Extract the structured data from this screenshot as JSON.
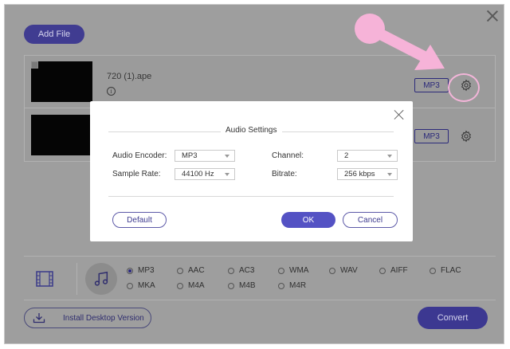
{
  "toolbar": {
    "add_file_label": "Add File"
  },
  "files": [
    {
      "name": "720 (1).ape",
      "format": "MP3"
    },
    {
      "name": "",
      "format": "MP3"
    }
  ],
  "audio_settings": {
    "title": "Audio Settings",
    "encoder_label": "Audio Encoder:",
    "encoder_value": "MP3",
    "sample_rate_label": "Sample Rate:",
    "sample_rate_value": "44100 Hz",
    "channel_label": "Channel:",
    "channel_value": "2",
    "bitrate_label": "Bitrate:",
    "bitrate_value": "256 kbps",
    "default_label": "Default",
    "ok_label": "OK",
    "cancel_label": "Cancel"
  },
  "formats": {
    "selected": "MP3",
    "row1": [
      "MP3",
      "AAC",
      "AC3",
      "WMA",
      "WAV",
      "AIFF",
      "FLAC"
    ],
    "row2": [
      "MKA",
      "M4A",
      "M4B",
      "M4R"
    ]
  },
  "footer": {
    "install_label": "Install Desktop Version",
    "convert_label": "Convert"
  },
  "icons": {
    "close": "close-icon",
    "gear": "gear-icon",
    "info": "info-icon",
    "video": "film-icon",
    "audio": "music-note-icon",
    "download": "download-icon"
  },
  "colors": {
    "accent": "#403c91",
    "modal_primary": "#5452c4",
    "annotation_arrow": "#f6b3d8"
  }
}
